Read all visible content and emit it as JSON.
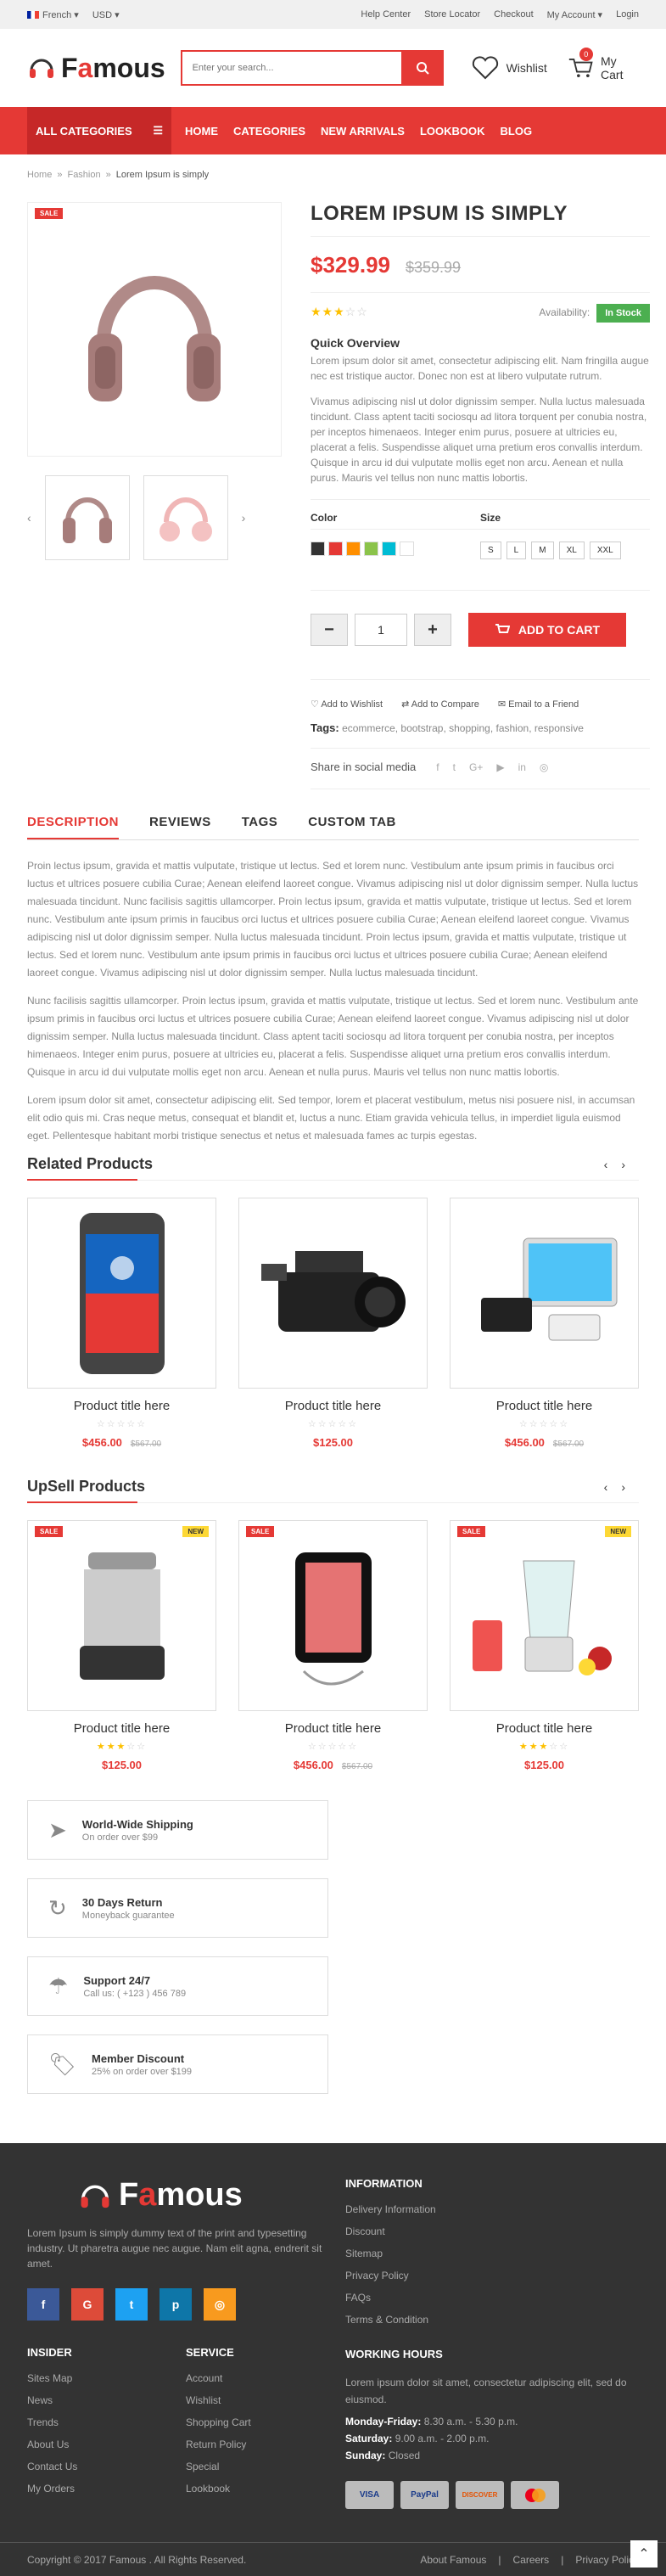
{
  "topbar": {
    "language": "French",
    "currency": "USD",
    "links": [
      "Help Center",
      "Store Locator",
      "Checkout",
      "My Account",
      "Login"
    ]
  },
  "header": {
    "logo_pre": "F",
    "logo_a": "a",
    "logo_post": "mous",
    "search_placeholder": "Enter your search...",
    "wishlist": "Wishlist",
    "cart": "My Cart",
    "cart_count": "0"
  },
  "nav": {
    "all_categories": "ALL CATEGORIES",
    "menu": [
      "HOME",
      "CATEGORIES",
      "NEW ARRIVALS",
      "LOOKBOOK",
      "BLOG"
    ]
  },
  "breadcrumb": [
    "Home",
    "Fashion",
    "Lorem Ipsum is simply"
  ],
  "product": {
    "sale": "SALE",
    "title": "LOREM IPSUM IS SIMPLY",
    "price": "$329.99",
    "old_price": "$359.99",
    "rating": 3,
    "availability_label": "Availability:",
    "availability": "In Stock",
    "overview_title": "Quick Overview",
    "overview_1": "Lorem ipsum dolor sit amet, consectetur adipiscing elit. Nam fringilla augue nec est tristique auctor. Donec non est at libero vulputate rutrum.",
    "overview_2": "Vivamus adipiscing nisl ut dolor dignissim semper. Nulla luctus malesuada tincidunt. Class aptent taciti sociosqu ad litora torquent per conubia nostra, per inceptos himenaeos. Integer enim purus, posuere at ultricies eu, placerat a felis. Suspendisse aliquet urna pretium eros convallis interdum. Quisque in arcu id dui vulputate mollis eget non arcu. Aenean et nulla purus. Mauris vel tellus non nunc mattis lobortis.",
    "color_label": "Color",
    "colors": [
      "#333333",
      "#e53935",
      "#ff8f00",
      "#8bc34a",
      "#00bcd4",
      "#ffffff"
    ],
    "size_label": "Size",
    "sizes": [
      "S",
      "L",
      "M",
      "XL",
      "XXL"
    ],
    "qty": "1",
    "add_to_cart": "ADD TO CART",
    "actions": [
      "Add to Wishlist",
      "Add to Compare",
      "Email to a Friend"
    ],
    "tags_label": "Tags:",
    "tags": "ecommerce, bootstrap, shopping, fashion, responsive",
    "share": "Share in social media"
  },
  "tabs": [
    "DESCRIPTION",
    "REVIEWS",
    "TAGS",
    "CUSTOM TAB"
  ],
  "description": [
    "Proin lectus ipsum, gravida et mattis vulputate, tristique ut lectus. Sed et lorem nunc. Vestibulum ante ipsum primis in faucibus orci luctus et ultrices posuere cubilia Curae; Aenean eleifend laoreet congue. Vivamus adipiscing nisl ut dolor dignissim semper. Nulla luctus malesuada tincidunt. Nunc facilisis sagittis ullamcorper. Proin lectus ipsum, gravida et mattis vulputate, tristique ut lectus. Sed et lorem nunc. Vestibulum ante ipsum primis in faucibus orci luctus et ultrices posuere cubilia Curae; Aenean eleifend laoreet congue. Vivamus adipiscing nisl ut dolor dignissim semper. Nulla luctus malesuada tincidunt. Proin lectus ipsum, gravida et mattis vulputate, tristique ut lectus. Sed et lorem nunc. Vestibulum ante ipsum primis in faucibus orci luctus et ultrices posuere cubilia Curae; Aenean eleifend laoreet congue. Vivamus adipiscing nisl ut dolor dignissim semper. Nulla luctus malesuada tincidunt.",
    "Nunc facilisis sagittis ullamcorper. Proin lectus ipsum, gravida et mattis vulputate, tristique ut lectus. Sed et lorem nunc. Vestibulum ante ipsum primis in faucibus orci luctus et ultrices posuere cubilia Curae; Aenean eleifend laoreet congue. Vivamus adipiscing nisl ut dolor dignissim semper. Nulla luctus malesuada tincidunt. Class aptent taciti sociosqu ad litora torquent per conubia nostra, per inceptos himenaeos. Integer enim purus, posuere at ultricies eu, placerat a felis. Suspendisse aliquet urna pretium eros convallis interdum. Quisque in arcu id dui vulputate mollis eget non arcu. Aenean et nulla purus. Mauris vel tellus non nunc mattis lobortis.",
    "Lorem ipsum dolor sit amet, consectetur adipiscing elit. Sed tempor, lorem et placerat vestibulum, metus nisi posuere nisl, in accumsan elit odio quis mi. Cras neque metus, consequat et blandit et, luctus a nunc. Etiam gravida vehicula tellus, in imperdiet ligula euismod eget. Pellentesque habitant morbi tristique senectus et netus et malesuada fames ac turpis egestas."
  ],
  "related": {
    "title": "Related Products",
    "items": [
      {
        "title": "Product title here",
        "price": "$456.00",
        "old": "$567.00",
        "rating": 0
      },
      {
        "title": "Product title here",
        "price": "$125.00",
        "old": "",
        "rating": 0
      },
      {
        "title": "Product title here",
        "price": "$456.00",
        "old": "$567.00",
        "rating": 0
      }
    ]
  },
  "upsell": {
    "title": "UpSell Products",
    "items": [
      {
        "title": "Product title here",
        "price": "$125.00",
        "old": "",
        "rating": 3,
        "sale": "SALE",
        "new": "NEW"
      },
      {
        "title": "Product title here",
        "price": "$456.00",
        "old": "$567.00",
        "rating": 0,
        "sale": "SALE",
        "new": ""
      },
      {
        "title": "Product title here",
        "price": "$125.00",
        "old": "",
        "rating": 3,
        "sale": "SALE",
        "new": "NEW"
      }
    ]
  },
  "features": [
    {
      "title": "World-Wide Shipping",
      "sub": "On order over $99"
    },
    {
      "title": "30 Days Return",
      "sub": "Moneyback guarantee"
    },
    {
      "title": "Support 24/7",
      "sub": "Call us: ( +123 ) 456 789"
    },
    {
      "title": "Member Discount",
      "sub": "25% on order over $199"
    }
  ],
  "footer": {
    "about": "Lorem Ipsum is simply dummy text of the print and typesetting industry. Ut pharetra augue nec augue. Nam elit agna, endrerit sit amet.",
    "info_title": "INFORMATION",
    "info": [
      "Delivery Information",
      "Discount",
      "Sitemap",
      "Privacy Policy",
      "FAQs",
      "Terms & Condition"
    ],
    "insider_title": "INSIDER",
    "insider": [
      "Sites Map",
      "News",
      "Trends",
      "About Us",
      "Contact Us",
      "My Orders"
    ],
    "service_title": "SERVICE",
    "service": [
      "Account",
      "Wishlist",
      "Shopping Cart",
      "Return Policy",
      "Special",
      "Lookbook"
    ],
    "hours_title": "WORKING HOURS",
    "hours_text": "Lorem ipsum dolor sit amet, consectetur adipiscing elit, sed do eiusmod.",
    "mf_label": "Monday-Friday:",
    "mf": "8.30 a.m. - 5.30 p.m.",
    "sat_label": "Saturday:",
    "sat": "9.00 a.m. - 2.00 p.m.",
    "sun_label": "Sunday:",
    "sun": "Closed",
    "payments": [
      "VISA",
      "PayPal",
      "DISCOVER",
      "MC"
    ],
    "copyright": "Copyright © 2017 Famous . All Rights Reserved.",
    "bottom_links": [
      "About Famous",
      "Careers",
      "Privacy Policy"
    ]
  }
}
